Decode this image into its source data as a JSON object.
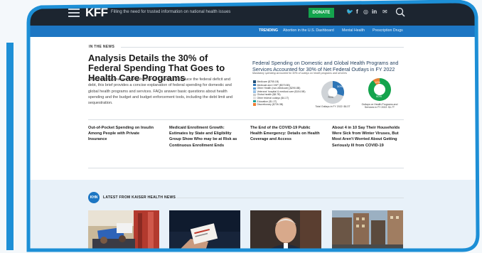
{
  "header": {
    "logo": "KFF",
    "tagline": "Filling the need for trusted information on national health issues",
    "donate_label": "DONATE",
    "social": {
      "twitter": "🐦",
      "facebook": "f",
      "instagram": "◎",
      "linkedin": "in",
      "email": "✉"
    }
  },
  "trending": {
    "label": "TRENDING",
    "links": [
      "Abortion in the U.S. Dashboard",
      "Mental Health",
      "Prescription Drugs"
    ]
  },
  "news": {
    "section_label": "IN THE NEWS",
    "headline": "Analysis Details the 30% of Federal Spending That Goes to Health Care Programs",
    "summary": "As some policymakers in Washington are pushing to reduce the federal deficit and debt, this brief provides a concise explanation of federal spending for domestic and global health programs and services. FAQs answer basic questions about health spending and the budget and budget enforcement tools, including the debt limit and sequestration."
  },
  "chart_data": {
    "type": "pie",
    "title": "Federal Spending on Domestic and Global Health Programs and Services Accounted for 30% of Net Federal Outlays in FY 2022",
    "subtitle": "Mandatory spending accounted for 90% of outlays on health programs and services",
    "slices": [
      {
        "name": "Medicare ($755.1B)",
        "color": "#1f4e79"
      },
      {
        "name": "Medicaid and CHIP ($579.5B)",
        "color": "#2e75b6"
      },
      {
        "name": "Other Health (non-Medicare) ($290.8B)",
        "color": "#5b9bd5"
      },
      {
        "name": "Veterans' hospital & medical care ($104.5B)",
        "color": "#9dc3e6"
      },
      {
        "name": "Global health ($8.7B)",
        "color": "#c9c9c9"
      },
      {
        "name": "Other federal outlays ($4.1T)",
        "color": "#e0e0e0"
      },
      {
        "name": "Education ($1.1T)",
        "color": "#1ba39c"
      },
      {
        "name": "Discretionary ($726.3B)",
        "color": "#ed7d31"
      }
    ],
    "pies": [
      {
        "label": "Total Outlays in FY 2022: $6.3T",
        "center_text": "70%",
        "center_text_2": "30%"
      },
      {
        "label": "Outlays on Health Programs and Services in FY 2022: $1.7T",
        "center_text": "10%",
        "center_text_2": "90%"
      }
    ]
  },
  "stories": [
    "Out-of-Pocket Spending on Insulin Among People with Private Insurance",
    "Medicaid Enrollment Growth: Estimates by State and Eligibility Group Show Who may be at Risk as Continuous Enrollment Ends",
    "The End of the COVID-19 Public Health Emergency: Details on Health Coverage and Access",
    "About 4 in 10 Say Their Households Were Sick from Winter Viruses, But Most Aren't Worried About Getting Seriously Ill from COVID-19"
  ],
  "khn": {
    "logo": "KHN",
    "section_label": "LATEST FROM KAISER HEALTH NEWS"
  },
  "colors": {
    "header_bg": "#1c2530",
    "trending_bg": "#1d76c3",
    "donate": "#14a44d",
    "frame_accent": "#1d8fd6"
  }
}
